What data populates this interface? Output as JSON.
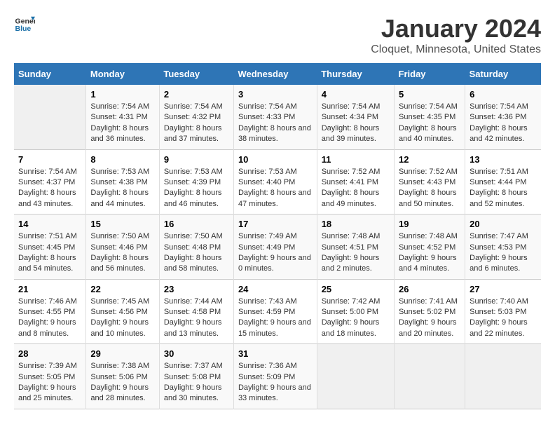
{
  "logo": {
    "text_general": "General",
    "text_blue": "Blue"
  },
  "title": "January 2024",
  "subtitle": "Cloquet, Minnesota, United States",
  "days_of_week": [
    "Sunday",
    "Monday",
    "Tuesday",
    "Wednesday",
    "Thursday",
    "Friday",
    "Saturday"
  ],
  "weeks": [
    [
      {
        "day": "",
        "sunrise": "",
        "sunset": "",
        "daylight": "",
        "empty": true
      },
      {
        "day": "1",
        "sunrise": "Sunrise: 7:54 AM",
        "sunset": "Sunset: 4:31 PM",
        "daylight": "Daylight: 8 hours and 36 minutes."
      },
      {
        "day": "2",
        "sunrise": "Sunrise: 7:54 AM",
        "sunset": "Sunset: 4:32 PM",
        "daylight": "Daylight: 8 hours and 37 minutes."
      },
      {
        "day": "3",
        "sunrise": "Sunrise: 7:54 AM",
        "sunset": "Sunset: 4:33 PM",
        "daylight": "Daylight: 8 hours and 38 minutes."
      },
      {
        "day": "4",
        "sunrise": "Sunrise: 7:54 AM",
        "sunset": "Sunset: 4:34 PM",
        "daylight": "Daylight: 8 hours and 39 minutes."
      },
      {
        "day": "5",
        "sunrise": "Sunrise: 7:54 AM",
        "sunset": "Sunset: 4:35 PM",
        "daylight": "Daylight: 8 hours and 40 minutes."
      },
      {
        "day": "6",
        "sunrise": "Sunrise: 7:54 AM",
        "sunset": "Sunset: 4:36 PM",
        "daylight": "Daylight: 8 hours and 42 minutes."
      }
    ],
    [
      {
        "day": "7",
        "sunrise": "Sunrise: 7:54 AM",
        "sunset": "Sunset: 4:37 PM",
        "daylight": "Daylight: 8 hours and 43 minutes."
      },
      {
        "day": "8",
        "sunrise": "Sunrise: 7:53 AM",
        "sunset": "Sunset: 4:38 PM",
        "daylight": "Daylight: 8 hours and 44 minutes."
      },
      {
        "day": "9",
        "sunrise": "Sunrise: 7:53 AM",
        "sunset": "Sunset: 4:39 PM",
        "daylight": "Daylight: 8 hours and 46 minutes."
      },
      {
        "day": "10",
        "sunrise": "Sunrise: 7:53 AM",
        "sunset": "Sunset: 4:40 PM",
        "daylight": "Daylight: 8 hours and 47 minutes."
      },
      {
        "day": "11",
        "sunrise": "Sunrise: 7:52 AM",
        "sunset": "Sunset: 4:41 PM",
        "daylight": "Daylight: 8 hours and 49 minutes."
      },
      {
        "day": "12",
        "sunrise": "Sunrise: 7:52 AM",
        "sunset": "Sunset: 4:43 PM",
        "daylight": "Daylight: 8 hours and 50 minutes."
      },
      {
        "day": "13",
        "sunrise": "Sunrise: 7:51 AM",
        "sunset": "Sunset: 4:44 PM",
        "daylight": "Daylight: 8 hours and 52 minutes."
      }
    ],
    [
      {
        "day": "14",
        "sunrise": "Sunrise: 7:51 AM",
        "sunset": "Sunset: 4:45 PM",
        "daylight": "Daylight: 8 hours and 54 minutes."
      },
      {
        "day": "15",
        "sunrise": "Sunrise: 7:50 AM",
        "sunset": "Sunset: 4:46 PM",
        "daylight": "Daylight: 8 hours and 56 minutes."
      },
      {
        "day": "16",
        "sunrise": "Sunrise: 7:50 AM",
        "sunset": "Sunset: 4:48 PM",
        "daylight": "Daylight: 8 hours and 58 minutes."
      },
      {
        "day": "17",
        "sunrise": "Sunrise: 7:49 AM",
        "sunset": "Sunset: 4:49 PM",
        "daylight": "Daylight: 9 hours and 0 minutes."
      },
      {
        "day": "18",
        "sunrise": "Sunrise: 7:48 AM",
        "sunset": "Sunset: 4:51 PM",
        "daylight": "Daylight: 9 hours and 2 minutes."
      },
      {
        "day": "19",
        "sunrise": "Sunrise: 7:48 AM",
        "sunset": "Sunset: 4:52 PM",
        "daylight": "Daylight: 9 hours and 4 minutes."
      },
      {
        "day": "20",
        "sunrise": "Sunrise: 7:47 AM",
        "sunset": "Sunset: 4:53 PM",
        "daylight": "Daylight: 9 hours and 6 minutes."
      }
    ],
    [
      {
        "day": "21",
        "sunrise": "Sunrise: 7:46 AM",
        "sunset": "Sunset: 4:55 PM",
        "daylight": "Daylight: 9 hours and 8 minutes."
      },
      {
        "day": "22",
        "sunrise": "Sunrise: 7:45 AM",
        "sunset": "Sunset: 4:56 PM",
        "daylight": "Daylight: 9 hours and 10 minutes."
      },
      {
        "day": "23",
        "sunrise": "Sunrise: 7:44 AM",
        "sunset": "Sunset: 4:58 PM",
        "daylight": "Daylight: 9 hours and 13 minutes."
      },
      {
        "day": "24",
        "sunrise": "Sunrise: 7:43 AM",
        "sunset": "Sunset: 4:59 PM",
        "daylight": "Daylight: 9 hours and 15 minutes."
      },
      {
        "day": "25",
        "sunrise": "Sunrise: 7:42 AM",
        "sunset": "Sunset: 5:00 PM",
        "daylight": "Daylight: 9 hours and 18 minutes."
      },
      {
        "day": "26",
        "sunrise": "Sunrise: 7:41 AM",
        "sunset": "Sunset: 5:02 PM",
        "daylight": "Daylight: 9 hours and 20 minutes."
      },
      {
        "day": "27",
        "sunrise": "Sunrise: 7:40 AM",
        "sunset": "Sunset: 5:03 PM",
        "daylight": "Daylight: 9 hours and 22 minutes."
      }
    ],
    [
      {
        "day": "28",
        "sunrise": "Sunrise: 7:39 AM",
        "sunset": "Sunset: 5:05 PM",
        "daylight": "Daylight: 9 hours and 25 minutes."
      },
      {
        "day": "29",
        "sunrise": "Sunrise: 7:38 AM",
        "sunset": "Sunset: 5:06 PM",
        "daylight": "Daylight: 9 hours and 28 minutes."
      },
      {
        "day": "30",
        "sunrise": "Sunrise: 7:37 AM",
        "sunset": "Sunset: 5:08 PM",
        "daylight": "Daylight: 9 hours and 30 minutes."
      },
      {
        "day": "31",
        "sunrise": "Sunrise: 7:36 AM",
        "sunset": "Sunset: 5:09 PM",
        "daylight": "Daylight: 9 hours and 33 minutes."
      },
      {
        "day": "",
        "sunrise": "",
        "sunset": "",
        "daylight": "",
        "empty": true
      },
      {
        "day": "",
        "sunrise": "",
        "sunset": "",
        "daylight": "",
        "empty": true
      },
      {
        "day": "",
        "sunrise": "",
        "sunset": "",
        "daylight": "",
        "empty": true
      }
    ]
  ]
}
